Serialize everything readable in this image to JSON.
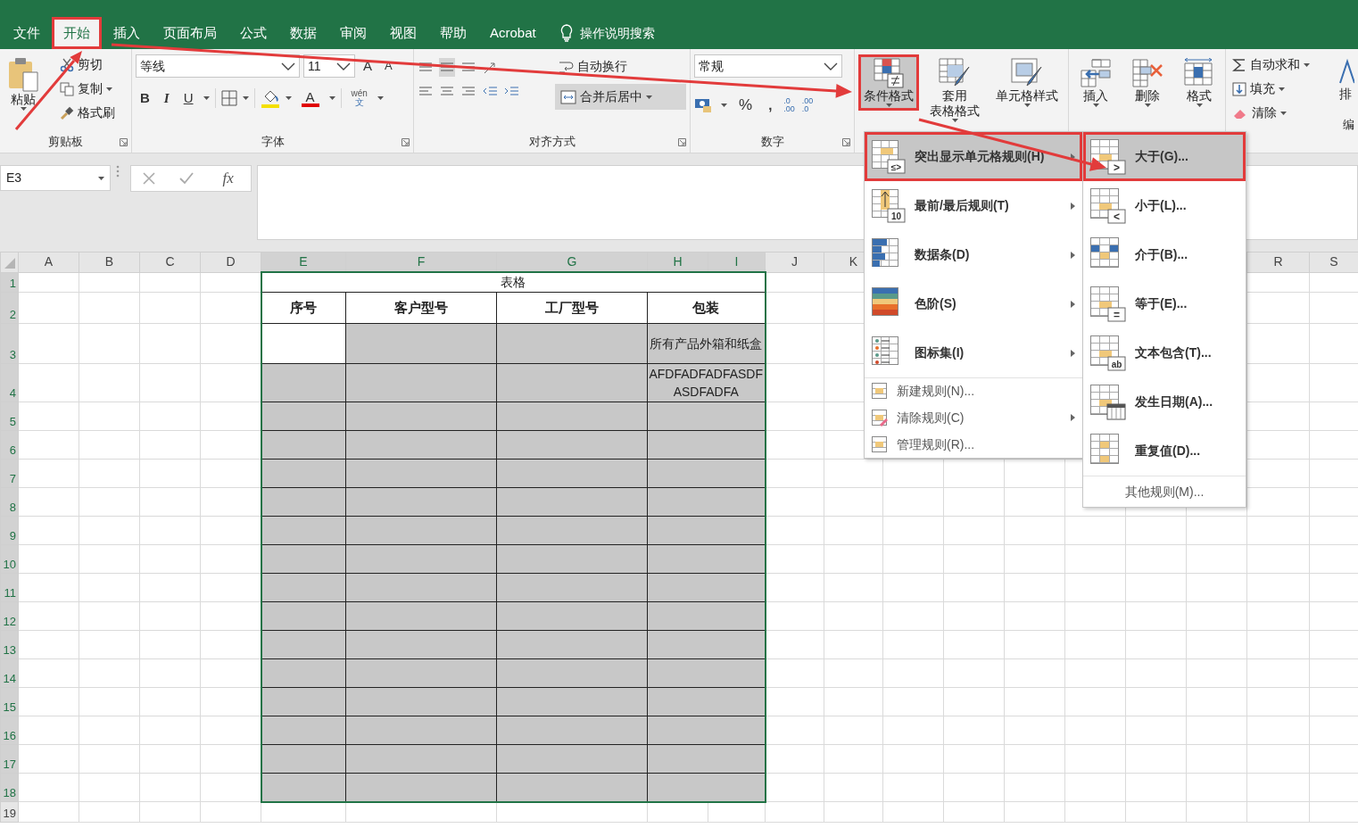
{
  "tabs": [
    {
      "label": "文件",
      "selected": false,
      "marked": false
    },
    {
      "label": "开始",
      "selected": true,
      "marked": true
    },
    {
      "label": "插入",
      "selected": false,
      "marked": false
    },
    {
      "label": "页面布局",
      "selected": false,
      "marked": false
    },
    {
      "label": "公式",
      "selected": false,
      "marked": false
    },
    {
      "label": "数据",
      "selected": false,
      "marked": false
    },
    {
      "label": "审阅",
      "selected": false,
      "marked": false
    },
    {
      "label": "视图",
      "selected": false,
      "marked": false
    },
    {
      "label": "帮助",
      "selected": false,
      "marked": false
    },
    {
      "label": "Acrobat",
      "selected": false,
      "marked": false
    }
  ],
  "tell_me": "操作说明搜索",
  "clipboard": {
    "paste": "粘贴",
    "cut": "剪切",
    "copy": "复制",
    "format_painter": "格式刷",
    "label": "剪贴板"
  },
  "font": {
    "name": "等线",
    "size": "11",
    "grow": "A",
    "shrink": "A",
    "bold": "B",
    "italic": "I",
    "underline": "U",
    "font_color": "A",
    "phonetic_top": "wén",
    "phonetic": "文",
    "label": "字体"
  },
  "alignment": {
    "wrap_text": "自动换行",
    "merge_center": "合并后居中",
    "label": "对齐方式"
  },
  "number": {
    "format": "常规",
    "percent": "%",
    "comma": ",",
    "increase_decimal": [
      ".0",
      ".00"
    ],
    "decrease_decimal": [
      ".00",
      ".0"
    ],
    "label": "数字"
  },
  "styles": [
    {
      "lines": [
        "条件格式"
      ],
      "pressed": true,
      "marked": true
    },
    {
      "lines": [
        "套用",
        "表格格式"
      ],
      "pressed": false,
      "marked": false
    },
    {
      "lines": [
        "单元格样式"
      ],
      "pressed": false,
      "marked": false
    }
  ],
  "cells": [
    {
      "label": "插入"
    },
    {
      "label": "删除"
    },
    {
      "label": "格式"
    }
  ],
  "editing": {
    "autosum": "自动求和",
    "fill": "填充",
    "clear": "清除",
    "sort": "排",
    "label": "编"
  },
  "formula_bar": {
    "name_box": "E3",
    "function": "fx"
  },
  "sheet": {
    "columns": [
      {
        "label": "A",
        "selected": false
      },
      {
        "label": "B",
        "selected": false
      },
      {
        "label": "C",
        "selected": false
      },
      {
        "label": "D",
        "selected": false
      },
      {
        "label": "E",
        "selected": true
      },
      {
        "label": "F",
        "selected": true
      },
      {
        "label": "G",
        "selected": true
      },
      {
        "label": "H",
        "selected": true
      },
      {
        "label": "I",
        "selected": true
      },
      {
        "label": "J",
        "selected": false
      },
      {
        "label": "K",
        "selected": false
      }
    ],
    "columns_right": [
      {
        "label": "R",
        "selected": false
      },
      {
        "label": "S",
        "selected": false
      }
    ],
    "rows": [
      {
        "label": "1",
        "selected": true
      },
      {
        "label": "2",
        "selected": true
      },
      {
        "label": "3",
        "selected": true
      },
      {
        "label": "4",
        "selected": true
      },
      {
        "label": "5",
        "selected": true
      },
      {
        "label": "6",
        "selected": true
      },
      {
        "label": "7",
        "selected": true
      },
      {
        "label": "8",
        "selected": true
      },
      {
        "label": "9",
        "selected": true
      },
      {
        "label": "10",
        "selected": true
      },
      {
        "label": "11",
        "selected": true
      },
      {
        "label": "12",
        "selected": true
      },
      {
        "label": "13",
        "selected": true
      },
      {
        "label": "14",
        "selected": true
      },
      {
        "label": "15",
        "selected": true
      },
      {
        "label": "16",
        "selected": true
      },
      {
        "label": "17",
        "selected": true
      },
      {
        "label": "18",
        "selected": true
      },
      {
        "label": "19",
        "selected": false
      }
    ],
    "table": {
      "title": "表格",
      "headers": [
        "序号",
        "客户型号",
        "工厂型号",
        "包装"
      ],
      "rows": [
        {
          "cells": [
            {
              "highlighted": false
            },
            {
              "highlighted": true
            },
            {
              "highlighted": true
            },
            {
              "highlighted": true,
              "text": "所有产品外箱和纸盒"
            }
          ]
        },
        {
          "cells": [
            {
              "highlighted": true
            },
            {
              "highlighted": true
            },
            {
              "highlighted": true
            },
            {
              "highlighted": true,
              "text": "AFDFADFADFASDFASDFADFA"
            }
          ]
        },
        {
          "cells": [
            {
              "highlighted": true
            },
            {
              "highlighted": true
            },
            {
              "highlighted": true
            },
            {
              "highlighted": true
            }
          ]
        },
        {
          "cells": [
            {
              "highlighted": true
            },
            {
              "highlighted": true
            },
            {
              "highlighted": true
            },
            {
              "highlighted": true
            }
          ]
        },
        {
          "cells": [
            {
              "highlighted": true
            },
            {
              "highlighted": true
            },
            {
              "highlighted": true
            },
            {
              "highlighted": true
            }
          ]
        },
        {
          "cells": [
            {
              "highlighted": true
            },
            {
              "highlighted": true
            },
            {
              "highlighted": true
            },
            {
              "highlighted": true
            }
          ]
        },
        {
          "cells": [
            {
              "highlighted": true
            },
            {
              "highlighted": true
            },
            {
              "highlighted": true
            },
            {
              "highlighted": true
            }
          ]
        },
        {
          "cells": [
            {
              "highlighted": true
            },
            {
              "highlighted": true
            },
            {
              "highlighted": true
            },
            {
              "highlighted": true
            }
          ]
        },
        {
          "cells": [
            {
              "highlighted": true
            },
            {
              "highlighted": true
            },
            {
              "highlighted": true
            },
            {
              "highlighted": true
            }
          ]
        },
        {
          "cells": [
            {
              "highlighted": true
            },
            {
              "highlighted": true
            },
            {
              "highlighted": true
            },
            {
              "highlighted": true
            }
          ]
        },
        {
          "cells": [
            {
              "highlighted": true
            },
            {
              "highlighted": true
            },
            {
              "highlighted": true
            },
            {
              "highlighted": true
            }
          ]
        },
        {
          "cells": [
            {
              "highlighted": true
            },
            {
              "highlighted": true
            },
            {
              "highlighted": true
            },
            {
              "highlighted": true
            }
          ]
        },
        {
          "cells": [
            {
              "highlighted": true
            },
            {
              "highlighted": true
            },
            {
              "highlighted": true
            },
            {
              "highlighted": true
            }
          ]
        },
        {
          "cells": [
            {
              "highlighted": true
            },
            {
              "highlighted": true
            },
            {
              "highlighted": true
            },
            {
              "highlighted": true
            }
          ]
        },
        {
          "cells": [
            {
              "highlighted": true
            },
            {
              "highlighted": true
            },
            {
              "highlighted": true
            },
            {
              "highlighted": true
            }
          ]
        },
        {
          "cells": [
            {
              "highlighted": true
            },
            {
              "highlighted": true
            },
            {
              "highlighted": true
            },
            {
              "highlighted": true
            }
          ]
        }
      ]
    }
  },
  "conditional_menu": {
    "items": [
      {
        "kind": "large",
        "label": "突出显示单元格规则(H)",
        "icon_text": "≤>",
        "submenu": true,
        "selected": true,
        "marked": true
      },
      {
        "kind": "large",
        "label": "最前/最后规则(T)",
        "icon_text": "10",
        "submenu": true,
        "selected": false,
        "marked": false
      },
      {
        "kind": "large",
        "label": "数据条(D)",
        "submenu": true,
        "selected": false,
        "marked": false
      },
      {
        "kind": "large",
        "label": "色阶(S)",
        "submenu": true,
        "selected": false,
        "marked": false
      },
      {
        "kind": "large",
        "label": "图标集(I)",
        "submenu": true,
        "selected": false,
        "marked": false
      },
      {
        "kind": "small",
        "label": "新建规则(N)...",
        "submenu": false,
        "selected": false,
        "marked": false
      },
      {
        "kind": "small",
        "label": "清除规则(C)",
        "submenu": true,
        "selected": false,
        "marked": false
      },
      {
        "kind": "small",
        "label": "管理规则(R)...",
        "submenu": false,
        "selected": false,
        "marked": false
      }
    ]
  },
  "highlight_submenu": {
    "items": [
      {
        "label": "大于(G)...",
        "icon_text": ">",
        "selected": true,
        "marked": true
      },
      {
        "label": "小于(L)...",
        "icon_text": "<",
        "selected": false,
        "marked": false
      },
      {
        "label": "介于(B)...",
        "selected": false,
        "marked": false
      },
      {
        "label": "等于(E)...",
        "icon_text": "=",
        "selected": false,
        "marked": false
      },
      {
        "label": "文本包含(T)...",
        "icon_text": "ab",
        "selected": false,
        "marked": false
      },
      {
        "label": "发生日期(A)...",
        "selected": false,
        "marked": false
      },
      {
        "label": "重复值(D)...",
        "selected": false,
        "marked": false
      }
    ],
    "more": "其他规则(M)..."
  }
}
